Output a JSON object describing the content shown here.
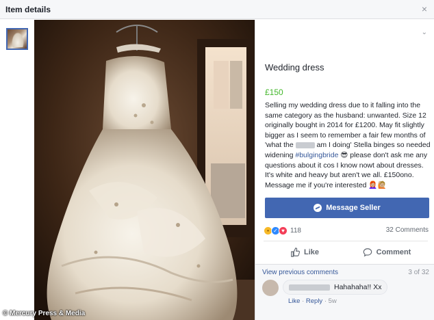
{
  "header": {
    "title": "Item details",
    "close_symbol": "×"
  },
  "listing": {
    "title": "Wedding dress",
    "price": "£150",
    "description_part1": "Selling my wedding dress due to it falling into the same category as the husband: unwanted. Size 12 originally bought in 2014 for £1200. May fit slightly bigger as I seem to remember a fair few months of 'what the ",
    "description_part2": " am I doing' Stella binges so needed widening ",
    "hashtag": "#bulgingbride",
    "emoji_cool": "😎",
    "description_part3": " please don't ask me any questions about it cos I know nowt about dresses. It's white and heavy but aren't we all. £150ono. Message me if you're interested ",
    "emoji_people": "👩🏼‍🦰🙋🏼",
    "message_button": "Message Seller"
  },
  "engagement": {
    "reaction_count": "118",
    "comment_count": "32 Comments",
    "like_label": "Like",
    "comment_label": "Comment"
  },
  "comments": {
    "view_previous": "View previous comments",
    "pager": "3 of 32",
    "items": [
      {
        "text": "Hahahaha!! Xx",
        "like": "Like",
        "reply": "Reply",
        "sep": "·",
        "age": "5w"
      }
    ]
  },
  "credit": "© Mercury Press & Media",
  "colors": {
    "brand": "#4267b2",
    "price": "#42b72a",
    "link": "#365899"
  }
}
